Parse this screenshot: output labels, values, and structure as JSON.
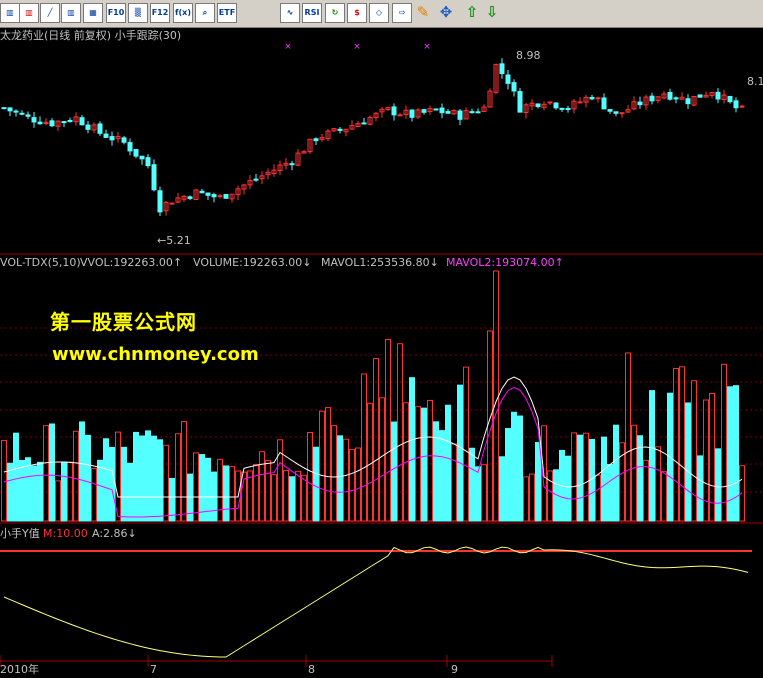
{
  "toolbar": {
    "buttons": [
      {
        "name": "bar-chart-icon",
        "glyph": "▥"
      },
      {
        "name": "kline-icon",
        "glyph": "▥"
      },
      {
        "name": "line-chart-icon",
        "glyph": "╱"
      },
      {
        "name": "candlestick-icon",
        "glyph": "▥"
      },
      {
        "name": "layout-icon",
        "glyph": "▦"
      },
      {
        "name": "f10-icon",
        "glyph": "F10"
      },
      {
        "name": "analysis-icon",
        "glyph": "▒"
      },
      {
        "name": "f11-icon",
        "glyph": "F12"
      },
      {
        "name": "formula-icon",
        "glyph": "f(x)"
      },
      {
        "name": "search-icon",
        "glyph": "⌕"
      },
      {
        "name": "etf-icon",
        "glyph": "ETF"
      },
      {
        "name": "wave-icon",
        "glyph": "∿"
      },
      {
        "name": "rsi-icon",
        "glyph": "RSI"
      },
      {
        "name": "refresh-icon",
        "glyph": "↻"
      },
      {
        "name": "money-icon",
        "glyph": "$"
      },
      {
        "name": "tag-icon",
        "glyph": "◇"
      },
      {
        "name": "export-icon",
        "glyph": "⇨"
      },
      {
        "name": "pencil-icon",
        "glyph": "✎"
      },
      {
        "name": "move-icon",
        "glyph": "✥"
      },
      {
        "name": "up-arrow-icon",
        "glyph": "⇧"
      },
      {
        "name": "down-arrow-icon",
        "glyph": "⇩"
      }
    ]
  },
  "price_panel": {
    "title": "太龙药业(日线 前复权) 小手跟踪(30)",
    "high_label": "8.98",
    "low_label": "←5.21",
    "right_label": "8.1"
  },
  "volume_panel": {
    "indicator": "VOL-TDX(5,10)",
    "vvol": "VVOL:192263.00↑",
    "volume": "VOLUME:192263.00↓",
    "mavol1": "MAVOL1:253536.80↓",
    "mavol2": "MAVOL2:193074.00↑",
    "watermark_cn": "第一股票公式网",
    "watermark_url": "www.chnmoney.com"
  },
  "indicator_panel": {
    "title": "小手Y值",
    "m_value": "M:10.00",
    "a_value": "A:2.86↓"
  },
  "time_axis": {
    "labels": [
      "2010年",
      "7",
      "8",
      "9"
    ]
  },
  "colors": {
    "up": "#ff3232",
    "down": "#54ffff",
    "ma1": "#ffffff",
    "ma2": "#ff00ff",
    "y_line": "#ffff80",
    "m_line": "#ff3232",
    "grid": "#800000",
    "watermark": "#ffff00"
  }
}
